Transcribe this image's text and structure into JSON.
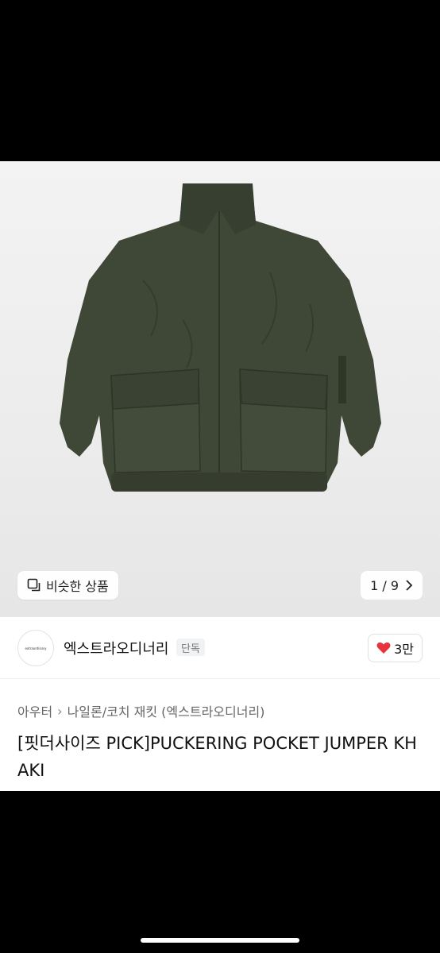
{
  "gallery": {
    "similar_label": "비슷한 상품",
    "counter": "1 / 9",
    "product_color": "#3e4636"
  },
  "brand": {
    "logo_text": "extraordinary",
    "name": "엑스트라오디너리",
    "badge": "단독",
    "likes": "3만"
  },
  "info": {
    "breadcrumb": [
      "아우터",
      "나일론/코치 재킷 (엑스트라오디너리)"
    ],
    "title": "[핏더사이즈 PICK]PUCKERING POCKET JUMPER KHAKI"
  }
}
